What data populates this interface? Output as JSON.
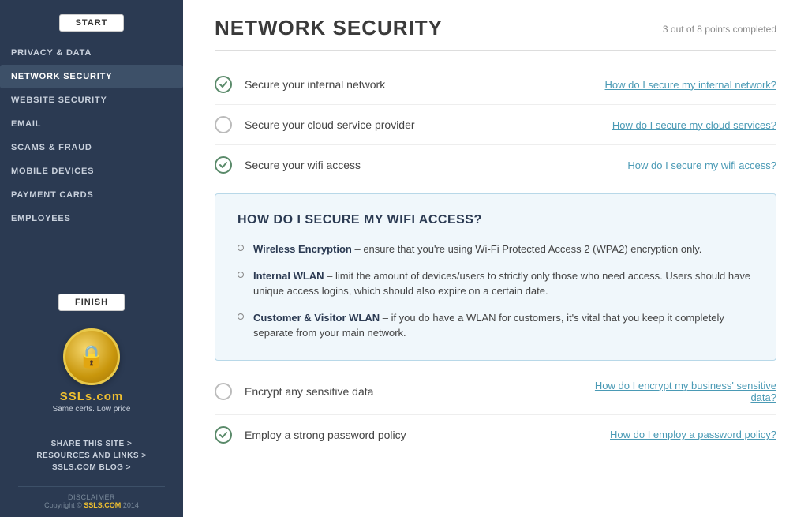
{
  "sidebar": {
    "start_label": "START",
    "finish_label": "FINISH",
    "nav_items": [
      {
        "id": "privacy-data",
        "label": "PRIVACY & DATA",
        "active": false
      },
      {
        "id": "network-security",
        "label": "NETWORK SECURITY",
        "active": true
      },
      {
        "id": "website-security",
        "label": "WEBSITE SECURITY",
        "active": false
      },
      {
        "id": "email",
        "label": "EMAIL",
        "active": false
      },
      {
        "id": "scams-fraud",
        "label": "SCAMS & FRAUD",
        "active": false
      },
      {
        "id": "mobile-devices",
        "label": "MOBILE DEVICES",
        "active": false
      },
      {
        "id": "payment-cards",
        "label": "PAYMENT CARDS",
        "active": false
      },
      {
        "id": "employees",
        "label": "EMPLOYEES",
        "active": false
      }
    ],
    "logo_text": "SSLs.com",
    "logo_tagline": "Same certs. Low price",
    "links": [
      {
        "id": "share",
        "label": "SHARE THIS SITE >"
      },
      {
        "id": "resources",
        "label": "RESOURCES AND LINKS >"
      },
      {
        "id": "blog",
        "label": "SSLS.COM BLOG >"
      }
    ],
    "disclaimer": "DISCLAIMER",
    "copyright": "Copyright © SSLS.COM 2014"
  },
  "main": {
    "page_title": "NETWORK SECURITY",
    "progress": "3 out of 8 points completed",
    "checklist": [
      {
        "id": "internal-network",
        "label": "Secure your internal network",
        "checked": true,
        "link": "How do I secure my internal network?",
        "expanded": false
      },
      {
        "id": "cloud-service",
        "label": "Secure your cloud service provider",
        "checked": false,
        "link": "How do I secure my cloud services?",
        "expanded": false
      },
      {
        "id": "wifi-access",
        "label": "Secure your wifi access",
        "checked": true,
        "link": "How do I secure my wifi access?",
        "expanded": true
      },
      {
        "id": "encrypt-data",
        "label": "Encrypt any sensitive data",
        "checked": false,
        "link_line1": "How do I encrypt my business' sensitive",
        "link_line2": "data?",
        "expanded": false,
        "multi_line_link": true
      },
      {
        "id": "password-policy",
        "label": "Employ a strong password policy",
        "checked": true,
        "link": "How do I employ a password policy?",
        "expanded": false
      }
    ],
    "expanded_panel": {
      "title": "HOW DO I SECURE MY WIFI ACCESS?",
      "items": [
        {
          "bold": "Wireless Encryption",
          "text": " – ensure that you're using Wi-Fi Protected Access 2 (WPA2) encryption only."
        },
        {
          "bold": "Internal WLAN",
          "text": " – limit the amount of devices/users to strictly only those who need access. Users should have unique access logins, which should also expire on a certain date."
        },
        {
          "bold": "Customer & Visitor WLAN",
          "text": " – if you do have a WLAN for customers, it's vital that you keep it completely separate from your main network."
        }
      ]
    }
  }
}
